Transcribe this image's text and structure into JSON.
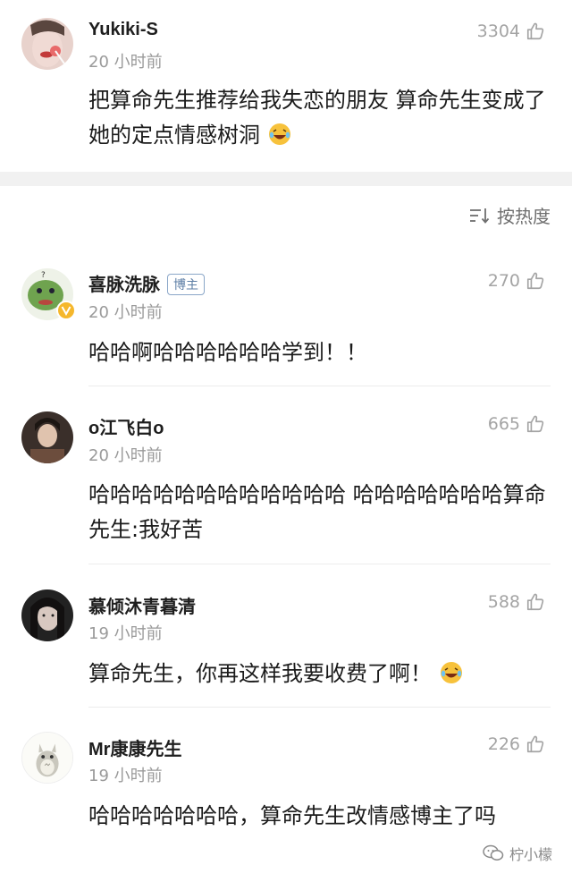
{
  "sort": {
    "label": "按热度",
    "icon": "sort-icon"
  },
  "comments": [
    {
      "name": "Yukiki-S",
      "time": "20 小时前",
      "likes": "3304",
      "text": "把算命先生推荐给我失恋的朋友 算命先生变成了她的定点情感树洞",
      "avatar": "lollipop-photo-avatar",
      "emoji": "laughing-crying-emoji"
    },
    {
      "name": "喜脉洗脉",
      "badge": "博主",
      "time": "20 小时前",
      "likes": "270",
      "text": "哈哈啊哈哈哈哈哈哈学到！！",
      "avatar": "green-frog-avatar",
      "verified": "verified-v-icon"
    },
    {
      "name": "o江飞白o",
      "time": "20 小时前",
      "likes": "665",
      "text": "哈哈哈哈哈哈哈哈哈哈哈哈 哈哈哈哈哈哈哈算命先生:我好苦",
      "avatar": "portrait-photo-avatar"
    },
    {
      "name": "慕倾沐青暮清",
      "time": "19 小时前",
      "likes": "588",
      "text": "算命先生，你再这样我要收费了啊！",
      "avatar": "dark-hair-avatar",
      "emoji": "laughing-crying-emoji"
    },
    {
      "name": "Mr康康先生",
      "time": "19 小时前",
      "likes": "226",
      "text": "哈哈哈哈哈哈哈，算命先生改情感博主了吗",
      "avatar": "totoro-avatar"
    }
  ],
  "watermark": {
    "text": "柠小檬",
    "icon": "wechat-icon"
  },
  "colors": {
    "muted": "#9a9a9a",
    "badge": "#5d7ea5",
    "band": "#f1f1f1",
    "emoji": "#f7c23c"
  }
}
